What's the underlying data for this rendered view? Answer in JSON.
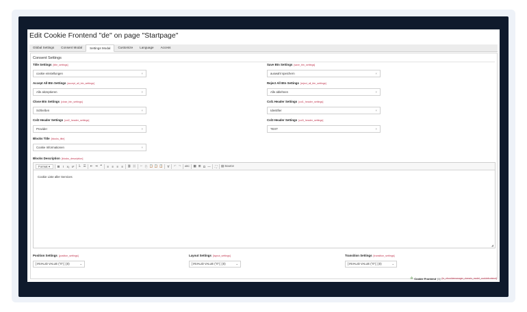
{
  "page": {
    "title": "Edit Cookie Frontend \"de\" on page \"Startpage\""
  },
  "tabs": [
    {
      "label": "Global Settings"
    },
    {
      "label": "Consent Modal"
    },
    {
      "label": "Settings Modal",
      "active": true
    },
    {
      "label": "Customize"
    },
    {
      "label": "Language"
    },
    {
      "label": "Access"
    }
  ],
  "section": {
    "heading": "Consent Settings"
  },
  "fields": {
    "title": {
      "label": "Title Settings",
      "code": "[title_settings]",
      "value": "cookie einstellungen",
      "clear": "×"
    },
    "save_btn": {
      "label": "Save Btn Settings",
      "code": "[save_btn_settings]",
      "value": "auswahl speichern",
      "clear": "×"
    },
    "accept_all": {
      "label": "Accept All Btn Settings",
      "code": "[accept_all_btn_settings]",
      "value": "Alle akzeptieren",
      "clear": "×"
    },
    "reject_all": {
      "label": "Reject All Btn Settings",
      "code": "[reject_all_btn_settings]",
      "value": "Alle ablehnen",
      "clear": "×"
    },
    "close_btn": {
      "label": "Close Btn Settings",
      "code": "[close_btn_settings]",
      "value": "Schließen",
      "clear": "×"
    },
    "col1_header": {
      "label": "Col1 Header Settings",
      "code": "[col1_header_settings]",
      "value": "Identifier",
      "clear": "×"
    },
    "col2_header": {
      "label": "Col2 Header Settings",
      "code": "[col2_header_settings]",
      "value": "Provider",
      "clear": "×"
    },
    "col3_header": {
      "label": "Col3 Header Settings",
      "code": "[col3_header_settings]",
      "value": "TEXT",
      "clear": "×"
    },
    "blocks_title": {
      "label": "Blocks Title",
      "code": "[blocks_title]",
      "value": "Cookie Informationen",
      "clear": "×"
    },
    "blocks_description": {
      "label": "Blocks Description",
      "code": "[blocks_description]"
    }
  },
  "editor": {
    "format_label": "Format",
    "format_arrow": "▾",
    "content": "Cookie Liste aller Services",
    "source_label": "Source",
    "buttons": {
      "bold": "B",
      "italic": "I",
      "subscript": "x₂",
      "superscript": "x²",
      "ordered_list": "⒈",
      "bullet_list": "☰",
      "outdent": "⇤",
      "indent": "⇥",
      "blockquote": "❝",
      "align_left": "≡",
      "align_center": "≡",
      "align_right": "≡",
      "justify": "≡",
      "link": "⛓",
      "unlink": "⛓",
      "cut": "✂",
      "copy": "⎘",
      "paste": "📋",
      "paste_text": "📋",
      "paste_word": "📋",
      "remove_format": "T̸",
      "undo": "↶",
      "redo": "↷",
      "spellcheck": "ABC",
      "table": "▦",
      "special_char": "Ω",
      "hr": "—",
      "image": "⊞",
      "maximize": "⛶",
      "source_icon": "▤"
    },
    "resize": "◢"
  },
  "bottom_fields": {
    "position": {
      "label": "Position Settings",
      "code": "[position_settings]",
      "value": "[ INVALID VALUE (\"0\") ] (0)",
      "chevron": "⌄"
    },
    "layout": {
      "label": "Layout Settings",
      "code": "[layout_settings]",
      "value": "[ INVALID VALUE (\"0\") ] (0)",
      "chevron": "⌄"
    },
    "transition": {
      "label": "Transition Settings",
      "code": "[transition_settings]",
      "value": "[ INVALID VALUE (\"0\") ] (0)",
      "chevron": "⌄"
    }
  },
  "footer": {
    "icon": "ılı",
    "record": "Cookie Frontend",
    "uid": "[1]",
    "table": "[tx_cfcookiemanager_domain_model_cookiefrontend]"
  }
}
